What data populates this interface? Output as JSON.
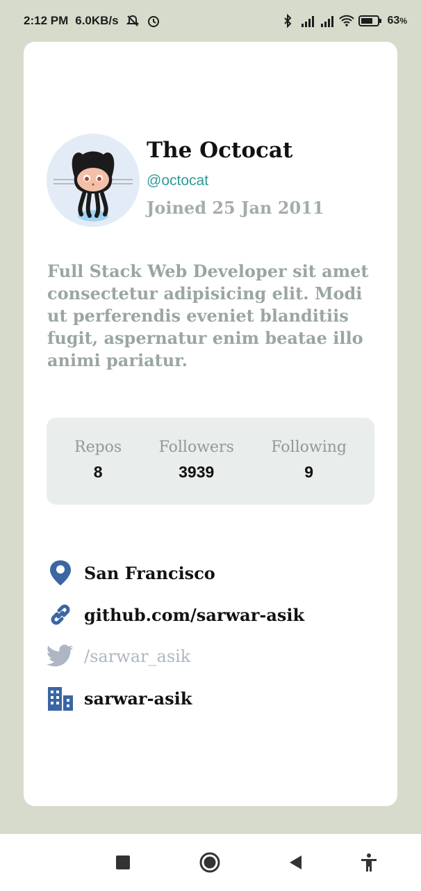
{
  "status_bar": {
    "time": "2:12 PM",
    "speed": "6.0KB/s",
    "battery": "63"
  },
  "profile": {
    "name": "The Octocat",
    "handle": "@octocat",
    "joined": "Joined 25 Jan 2011",
    "bio": "Full Stack Web Developer sit amet consectetur adipisicing elit. Modi ut perferendis eveniet blanditiis fugit, aspernatur enim beatae illo animi pariatur."
  },
  "stats": [
    {
      "label": "Repos",
      "value": "8"
    },
    {
      "label": "Followers",
      "value": "3939"
    },
    {
      "label": "Following",
      "value": "9"
    }
  ],
  "links": {
    "location": "San Francisco",
    "website": "github.com/sarwar-asik",
    "twitter": "/sarwar_asik",
    "company": "sarwar-asik"
  },
  "colors": {
    "background": "#d7dbcb",
    "accent": "#2f9a97",
    "icon_blue": "#3b66a3",
    "muted": "#9aa6a3"
  }
}
